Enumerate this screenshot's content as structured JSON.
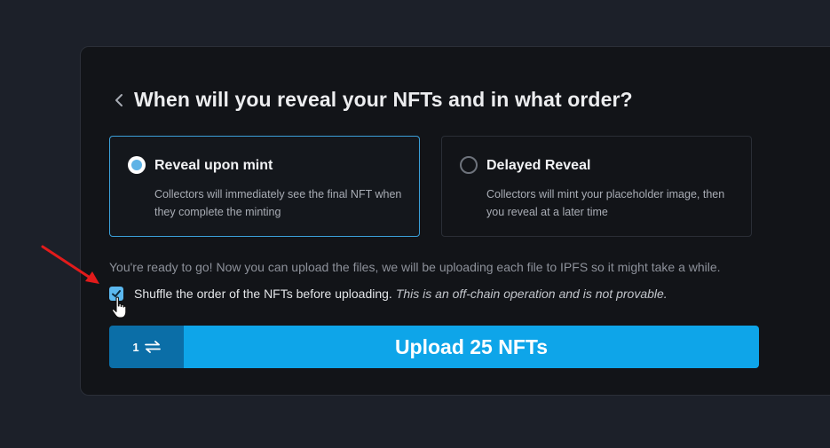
{
  "header": {
    "back_icon": "chevron-left-icon",
    "title": "When will you reveal your NFTs and in what order?"
  },
  "options": [
    {
      "title": "Reveal upon mint",
      "description": "Collectors will immediately see the final NFT when they complete the minting",
      "selected": true
    },
    {
      "title": "Delayed Reveal",
      "description": "Collectors will mint your placeholder image, then you reveal at a later time",
      "selected": false
    }
  ],
  "info_text": "You're ready to go! Now you can upload the files, we will be uploading each file to IPFS so it might take a while.",
  "shuffle": {
    "checked": true,
    "label": "Shuffle the order of the NFTs before uploading.",
    "note": "This is an off-chain operation and is not provable."
  },
  "upload": {
    "quantity": "1",
    "quantity_icon": "swap-arrows-icon",
    "label": "Upload 25 NFTs"
  },
  "colors": {
    "accent": "#0ea5e9",
    "accent_dark": "#0b6ea7",
    "selected_border": "#3b9fd8",
    "checkbox": "#5bb8ef",
    "annotation_arrow": "#e21b1b"
  }
}
